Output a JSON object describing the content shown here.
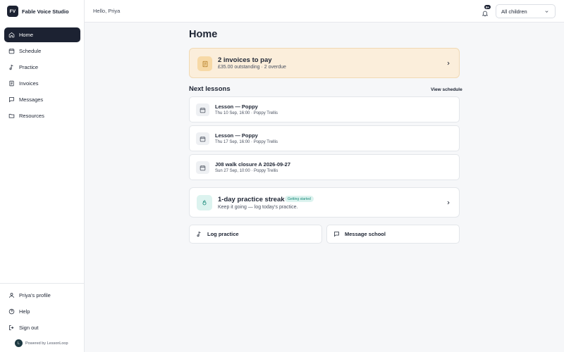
{
  "brand": {
    "logo_text": "FV",
    "name": "Fable Voice Studio"
  },
  "nav": {
    "items": [
      {
        "label": "Home",
        "icon": "home-icon",
        "active": true
      },
      {
        "label": "Schedule",
        "icon": "calendar-icon"
      },
      {
        "label": "Practice",
        "icon": "music-note-icon"
      },
      {
        "label": "Invoices",
        "icon": "receipt-icon"
      },
      {
        "label": "Messages",
        "icon": "message-icon"
      },
      {
        "label": "Resources",
        "icon": "folder-icon"
      }
    ],
    "bottom": [
      {
        "label": "Priya's profile",
        "icon": "user-icon"
      },
      {
        "label": "Help",
        "icon": "help-icon"
      },
      {
        "label": "Sign out",
        "icon": "sign-out-icon"
      }
    ],
    "powered_by": "Powered by LessonLoop",
    "powered_logo": "L"
  },
  "topbar": {
    "greeting": "Hello, Priya",
    "notification_badge": "9+",
    "child_selector": "All children"
  },
  "main": {
    "title": "Home",
    "invoices": {
      "title": "2 invoices to pay",
      "subtitle": "£35.00 outstanding · 2 overdue"
    },
    "next_lessons": {
      "title": "Next lessons",
      "view_link": "View schedule",
      "lessons": [
        {
          "title": "Lesson — Poppy",
          "meta": "Thu 10 Sep, 16:00 · Poppy Trellis"
        },
        {
          "title": "Lesson — Poppy",
          "meta": "Thu 17 Sep, 16:00 · Poppy Trellis"
        },
        {
          "title": "J08 walk closure A 2026-09-27",
          "meta": "Sun 27 Sep, 10:00 · Poppy Trellis"
        }
      ]
    },
    "streak": {
      "title": "1-day practice streak",
      "badge": "Getting started",
      "subtitle": "Keep it going — log today's practice."
    },
    "actions": {
      "log_practice": "Log practice",
      "message_school": "Message school"
    }
  },
  "colors": {
    "sidebar_active": "#1c2232",
    "invoice_bg": "#fbeedb",
    "streak_accent": "#1a8a79"
  }
}
